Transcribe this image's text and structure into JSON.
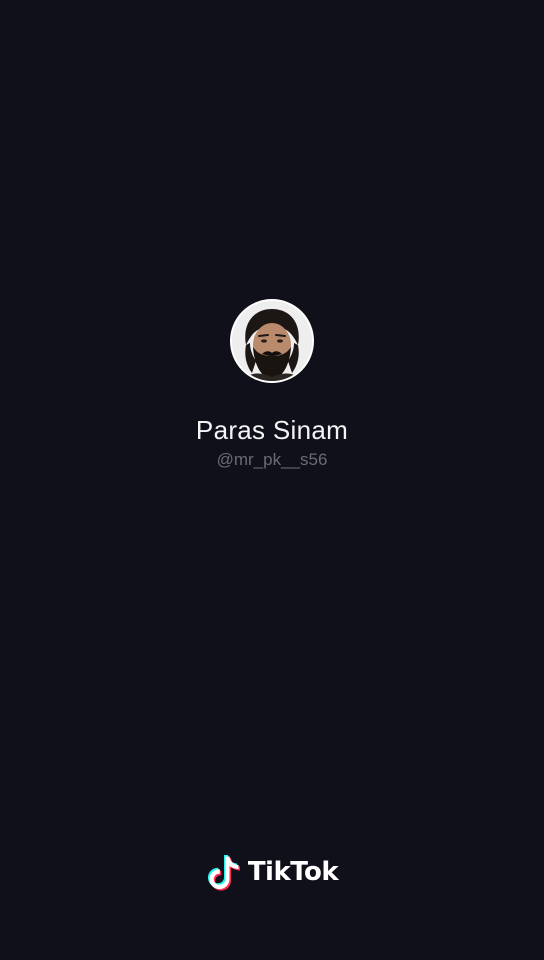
{
  "profile": {
    "display_name": "Paras Sinam",
    "username": "@mr_pk__s56",
    "avatar_icon": "profile-photo"
  },
  "branding": {
    "wordmark": "TikTok",
    "logo_icon": "tiktok-note-icon",
    "colors": {
      "background": "#10101a",
      "cyan": "#25f4ee",
      "pink": "#fe2c55",
      "white": "#ffffff"
    }
  }
}
